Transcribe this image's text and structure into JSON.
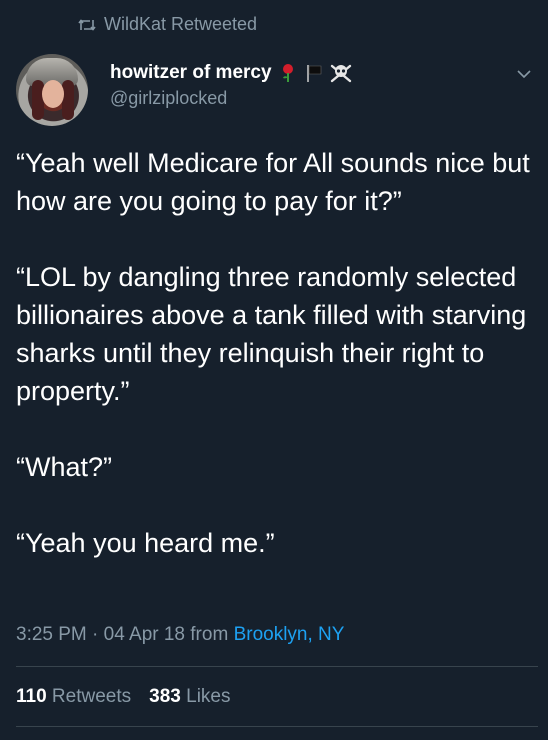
{
  "retweet_context": {
    "icon": "retweet-icon",
    "text": "WildKat Retweeted"
  },
  "author": {
    "display_name": "howitzer of mercy",
    "handle": "@girlziplocked",
    "emojis": [
      "rose-emoji",
      "black-flag-emoji",
      "skull-crossbones-emoji"
    ]
  },
  "tweet": {
    "paragraphs": [
      "“Yeah well Medicare for All sounds nice but how are you going to pay for it?”",
      "“LOL by dangling three randomly selected billionaires above a tank filled with starving sharks until they relinquish their right to property.”",
      "“What?”",
      "“Yeah you heard me.”"
    ]
  },
  "meta": {
    "time": "3:25 PM",
    "separator": " · ",
    "date": "04 Apr 18",
    "from": " from ",
    "location": "Brooklyn, NY"
  },
  "stats": {
    "retweets_count": "110",
    "retweets_label": " Retweets",
    "likes_count": "383",
    "likes_label": " Likes"
  },
  "colors": {
    "background": "#16202c",
    "muted": "#8899a6",
    "link": "#1da1f2",
    "divider": "#38444d"
  }
}
